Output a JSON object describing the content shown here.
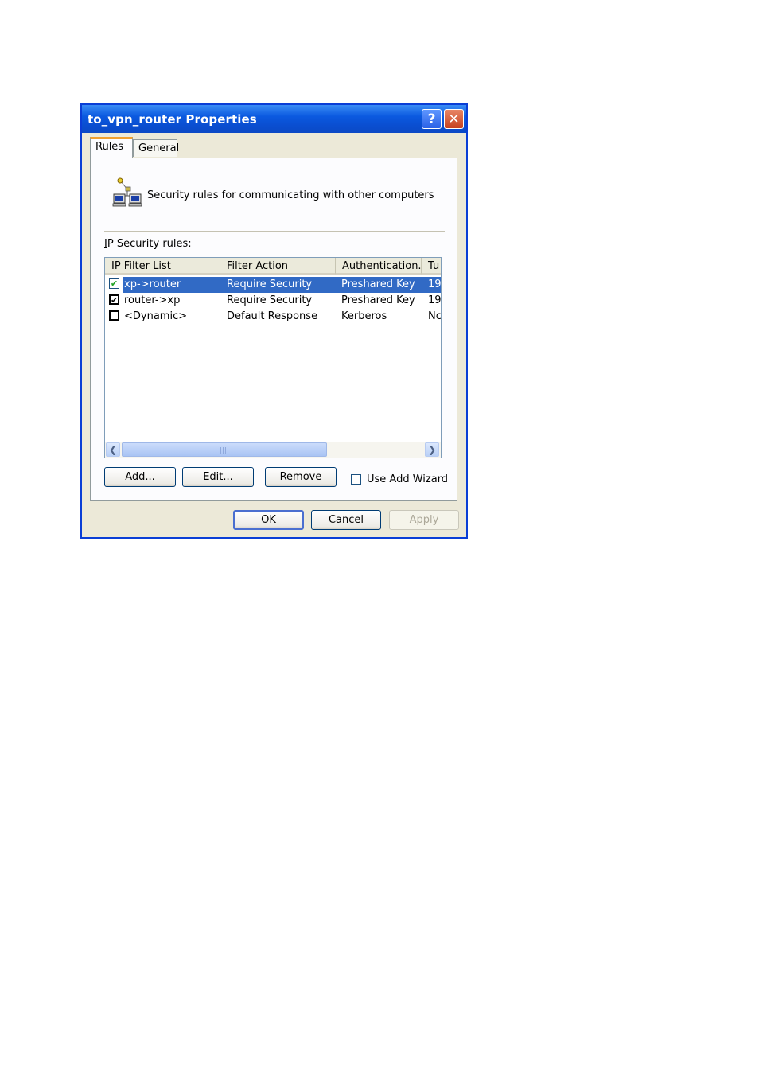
{
  "window": {
    "title": "to_vpn_router Properties"
  },
  "titlebar_buttons": {
    "help": "?",
    "close": "✕"
  },
  "tabs": [
    {
      "label": "Rules",
      "active": true
    },
    {
      "label": "General",
      "active": false
    }
  ],
  "rules_tab": {
    "description": "Security rules for communicating with other computers",
    "list_label": "IP Security rules:",
    "columns": [
      "IP Filter List",
      "Filter Action",
      "Authentication...",
      "Tu"
    ],
    "rows": [
      {
        "checked": true,
        "selected": true,
        "filter_list": "xp->router",
        "filter_action": "Require Security",
        "authentication": "Preshared Key",
        "tunnel": "19"
      },
      {
        "checked": true,
        "selected": false,
        "filter_list": "router->xp",
        "filter_action": "Require Security",
        "authentication": "Preshared Key",
        "tunnel": "19"
      },
      {
        "checked": false,
        "selected": false,
        "filter_list": "<Dynamic>",
        "filter_action": "Default Response",
        "authentication": "Kerberos",
        "tunnel": "Nc"
      }
    ],
    "buttons": {
      "add": "Add...",
      "edit": "Edit...",
      "remove": "Remove"
    },
    "use_add_wizard": {
      "label": "Use Add Wizard",
      "checked": false
    }
  },
  "footer": {
    "ok": "OK",
    "cancel": "Cancel",
    "apply": "Apply"
  },
  "colors": {
    "title_bar": "#0a4fd2",
    "selection": "#316ac5",
    "dialog_bg": "#ece9d8"
  }
}
